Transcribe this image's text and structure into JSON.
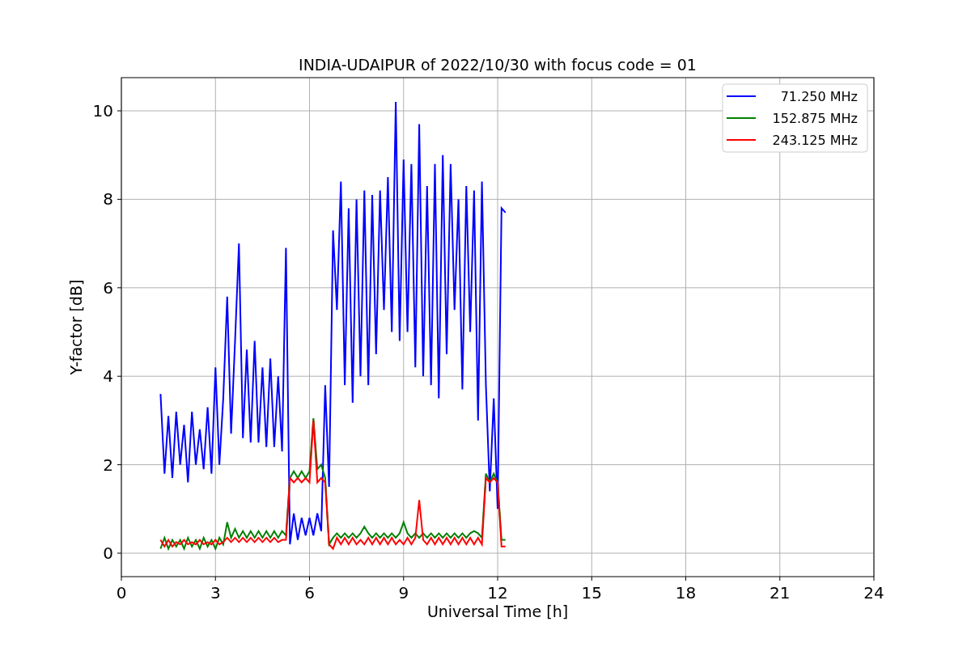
{
  "chart_data": {
    "type": "line",
    "title": "INDIA-UDAIPUR of 2022/10/30 with focus code = 01",
    "xlabel": "Universal Time [h]",
    "ylabel": "Y-factor [dB]",
    "x": [
      1.25,
      1.375,
      1.5,
      1.625,
      1.75,
      1.875,
      2,
      2.125,
      2.25,
      2.375,
      2.5,
      2.625,
      2.75,
      2.875,
      3,
      3.125,
      3.25,
      3.375,
      3.5,
      3.625,
      3.75,
      3.875,
      4,
      4.125,
      4.25,
      4.375,
      4.5,
      4.625,
      4.75,
      4.875,
      5,
      5.125,
      5.25,
      5.375,
      5.5,
      5.625,
      5.75,
      5.875,
      6,
      6.125,
      6.25,
      6.375,
      6.5,
      6.625,
      6.75,
      6.875,
      7,
      7.125,
      7.25,
      7.375,
      7.5,
      7.625,
      7.75,
      7.875,
      8,
      8.125,
      8.25,
      8.375,
      8.5,
      8.625,
      8.75,
      8.875,
      9,
      9.125,
      9.25,
      9.375,
      9.5,
      9.625,
      9.75,
      9.875,
      10,
      10.125,
      10.25,
      10.375,
      10.5,
      10.625,
      10.75,
      10.875,
      11,
      11.125,
      11.25,
      11.375,
      11.5,
      11.625,
      11.75,
      11.875,
      12,
      12.125,
      12.25
    ],
    "series": [
      {
        "name": "71.250 MHz",
        "color": "#0000ff",
        "values": [
          3.6,
          1.8,
          3.1,
          1.7,
          3.2,
          2.0,
          2.9,
          1.6,
          3.2,
          2.0,
          2.8,
          1.9,
          3.3,
          1.8,
          4.2,
          2.0,
          3.5,
          5.8,
          2.7,
          4.8,
          7.0,
          2.6,
          4.6,
          2.5,
          4.8,
          2.5,
          4.2,
          2.4,
          4.4,
          2.4,
          4.0,
          2.3,
          6.9,
          0.2,
          0.9,
          0.3,
          0.8,
          0.4,
          0.8,
          0.4,
          0.9,
          0.5,
          3.8,
          1.5,
          7.3,
          5.5,
          8.4,
          3.8,
          7.8,
          3.4,
          8.0,
          4.0,
          8.2,
          3.8,
          8.1,
          4.5,
          8.2,
          5.5,
          8.5,
          5.0,
          10.2,
          4.8,
          8.9,
          5.0,
          8.8,
          4.2,
          9.7,
          4.0,
          8.3,
          3.8,
          8.8,
          3.5,
          9.0,
          4.5,
          8.8,
          5.5,
          8.0,
          3.7,
          8.3,
          5.0,
          8.2,
          3.0,
          8.4,
          3.8,
          1.4,
          3.5,
          1.0,
          7.8,
          7.7
        ]
      },
      {
        "name": "152.875 MHz",
        "color": "#008000",
        "values": [
          0.1,
          0.35,
          0.1,
          0.3,
          0.15,
          0.3,
          0.1,
          0.35,
          0.15,
          0.3,
          0.1,
          0.35,
          0.15,
          0.3,
          0.1,
          0.35,
          0.2,
          0.7,
          0.35,
          0.55,
          0.35,
          0.5,
          0.35,
          0.5,
          0.35,
          0.5,
          0.35,
          0.5,
          0.35,
          0.5,
          0.35,
          0.5,
          0.4,
          1.7,
          1.85,
          1.7,
          1.85,
          1.7,
          1.85,
          3.05,
          1.9,
          2.0,
          1.7,
          0.2,
          0.35,
          0.45,
          0.35,
          0.45,
          0.35,
          0.45,
          0.35,
          0.45,
          0.6,
          0.45,
          0.35,
          0.45,
          0.35,
          0.45,
          0.35,
          0.45,
          0.35,
          0.45,
          0.7,
          0.45,
          0.35,
          0.45,
          0.35,
          0.45,
          0.35,
          0.45,
          0.35,
          0.45,
          0.35,
          0.45,
          0.35,
          0.45,
          0.35,
          0.45,
          0.35,
          0.45,
          0.5,
          0.45,
          0.35,
          1.8,
          1.6,
          1.8,
          1.6,
          0.3,
          0.3
        ]
      },
      {
        "name": "243.125 MHz",
        "color": "#ff0000",
        "values": [
          0.3,
          0.15,
          0.3,
          0.15,
          0.25,
          0.2,
          0.3,
          0.2,
          0.25,
          0.2,
          0.3,
          0.2,
          0.25,
          0.2,
          0.3,
          0.2,
          0.25,
          0.35,
          0.25,
          0.35,
          0.25,
          0.35,
          0.25,
          0.35,
          0.25,
          0.35,
          0.25,
          0.35,
          0.25,
          0.35,
          0.25,
          0.3,
          0.3,
          1.7,
          1.6,
          1.7,
          1.6,
          1.7,
          1.6,
          3.0,
          1.6,
          1.7,
          1.6,
          0.2,
          0.1,
          0.35,
          0.2,
          0.35,
          0.2,
          0.35,
          0.2,
          0.3,
          0.2,
          0.35,
          0.2,
          0.35,
          0.2,
          0.35,
          0.2,
          0.35,
          0.2,
          0.3,
          0.2,
          0.35,
          0.2,
          0.35,
          1.2,
          0.3,
          0.2,
          0.35,
          0.2,
          0.35,
          0.2,
          0.35,
          0.2,
          0.35,
          0.2,
          0.35,
          0.2,
          0.35,
          0.2,
          0.35,
          0.2,
          1.7,
          1.6,
          1.7,
          1.6,
          0.15,
          0.15
        ]
      }
    ],
    "xlim": [
      0,
      24
    ],
    "ylim": [
      -0.53,
      10.75
    ],
    "xticks": [
      0,
      3,
      6,
      9,
      12,
      15,
      18,
      21,
      24
    ],
    "yticks": [
      0,
      2,
      4,
      6,
      8,
      10
    ],
    "grid": true,
    "legend": true
  }
}
